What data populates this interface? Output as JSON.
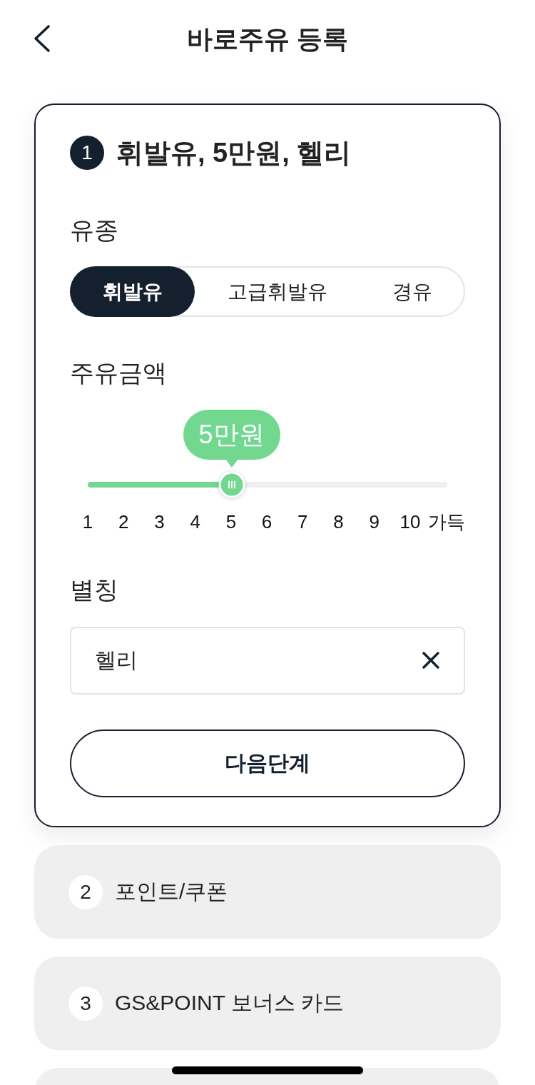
{
  "header": {
    "title": "바로주유 등록"
  },
  "active_step": {
    "number": "1",
    "title": "휘발유, 5만원, 헬리",
    "fuel_type": {
      "label": "유종",
      "options": [
        {
          "label": "휘발유",
          "selected": true
        },
        {
          "label": "고급휘발유",
          "selected": false
        },
        {
          "label": "경유",
          "selected": false
        }
      ]
    },
    "amount": {
      "label": "주유금액",
      "tooltip": "5만원",
      "level": 0.4,
      "ticks": [
        "1",
        "2",
        "3",
        "4",
        "5",
        "6",
        "7",
        "8",
        "9",
        "10",
        "가득"
      ]
    },
    "nickname": {
      "label": "별칭",
      "value": "헬리"
    },
    "next_button": "다음단계"
  },
  "steps": [
    {
      "number": "2",
      "label": "포인트/쿠폰"
    },
    {
      "number": "3",
      "label": "GS&POINT 보너스 카드"
    }
  ]
}
